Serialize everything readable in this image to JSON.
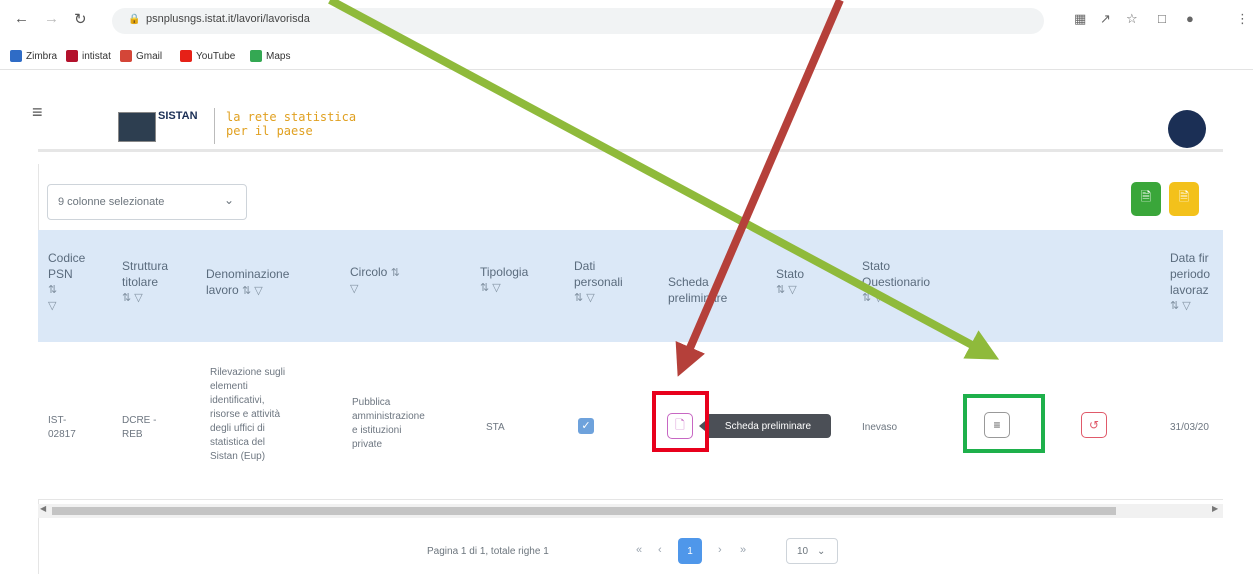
{
  "browser": {
    "url": "psnplusngs.istat.it/lavori/lavorisda",
    "bookmarks": [
      {
        "label": "Zimbra",
        "color": "#2f6cc6"
      },
      {
        "label": "intistat",
        "color": "#b3112c"
      },
      {
        "label": "Gmail",
        "color": "#d44638"
      },
      {
        "label": "YouTube",
        "color": "#e62117"
      },
      {
        "label": "Maps",
        "color": "#34a853"
      }
    ]
  },
  "header": {
    "logo_text": "SISTAN",
    "tagline_line1": "la rete statistica",
    "tagline_line2": "per il paese"
  },
  "toolbar": {
    "columns_select": "9 colonne selezionate"
  },
  "table": {
    "headers": {
      "codice": [
        "Codice",
        "PSN"
      ],
      "struttura": [
        "Struttura",
        "titolare"
      ],
      "denominazione": [
        "Denominazione",
        "lavoro"
      ],
      "circolo": "Circolo",
      "tipologia": "Tipologia",
      "dati": [
        "Dati",
        "personali"
      ],
      "scheda": [
        "Scheda",
        "preliminare"
      ],
      "stato": "Stato",
      "stato_q": [
        "Stato",
        "Questionario"
      ],
      "data": [
        "Data fir",
        "periodo",
        "lavoraz"
      ]
    },
    "row": {
      "codice": [
        "IST-",
        "02817"
      ],
      "struttura": [
        "DCRE -",
        "REB"
      ],
      "denominazione": [
        "Rilevazione sugli",
        "elementi",
        "identificativi,",
        "risorse e attività",
        "degli uffici di",
        "statistica del",
        "Sistan (Eup)"
      ],
      "circolo": [
        "Pubblica",
        "amministrazione",
        "e istituzioni",
        "private"
      ],
      "tipologia": "STA",
      "stato_q": "Inevaso",
      "data": "31/03/20"
    }
  },
  "tooltip": "Scheda preliminare",
  "pagination": {
    "text": "Pagina 1 di 1, totale righe 1",
    "current": "1",
    "page_size": "10"
  },
  "colors": {
    "header_bg": "#dbe8f7",
    "export_green": "#3aa63a",
    "export_yellow": "#f3c11b",
    "highlight_red": "#e8001c",
    "highlight_green": "#1eb04b",
    "arrow_red": "#b5403a",
    "arrow_green": "#8fba3b"
  }
}
